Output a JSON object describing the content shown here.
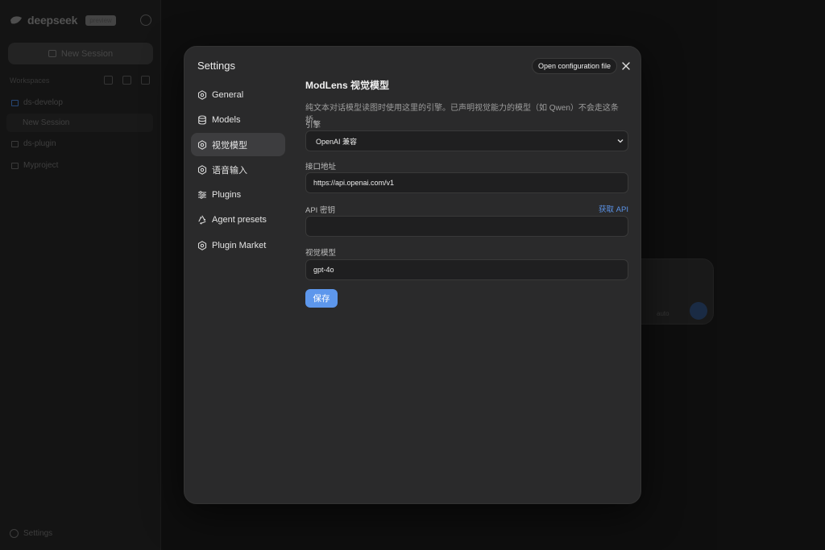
{
  "background": {
    "brand": {
      "name": "deepseek",
      "badge": "preview"
    },
    "new_session_label": "New Session",
    "workspaces_label": "Workspaces",
    "workspaces": [
      {
        "name": "ds-develop",
        "active": true
      },
      {
        "name": "ds-plugin",
        "active": false
      },
      {
        "name": "Myproject",
        "active": false
      }
    ],
    "session_label": "New Session",
    "settings_label": "Settings",
    "composer_model": "auto"
  },
  "modal": {
    "title": "Settings",
    "open_config_label": "Open configuration file",
    "nav": [
      {
        "label": "General",
        "icon": "gear-icon",
        "active": false
      },
      {
        "label": "Models",
        "icon": "database-icon",
        "active": false
      },
      {
        "label": "视觉模型",
        "icon": "gear-icon",
        "active": true
      },
      {
        "label": "语音输入",
        "icon": "gear-icon",
        "active": false
      },
      {
        "label": "Plugins",
        "icon": "sliders-icon",
        "active": false
      },
      {
        "label": "Agent presets",
        "icon": "recycle-icon",
        "active": false
      },
      {
        "label": "Plugin Market",
        "icon": "gear-icon",
        "active": false
      }
    ],
    "section": {
      "title": "ModLens 视觉模型",
      "description": "纯文本对话模型读图时使用这里的引擎。已声明视觉能力的模型（如 Qwen）不会走这条桥。",
      "engine_label": "引擎",
      "engine_value": "OpenAI 兼容",
      "endpoint_label": "接口地址",
      "endpoint_value": "https://api.openai.com/v1",
      "api_key_label": "API 密钥",
      "get_api_label": "获取 API",
      "api_key_value": "",
      "model_label": "视觉模型",
      "model_value": "gpt-4o",
      "save_label": "保存"
    }
  },
  "colors": {
    "accent": "#5d97ec",
    "link": "#5b93e8",
    "modal_bg": "#2a2a2b",
    "active_nav": "#3d3d3f"
  }
}
